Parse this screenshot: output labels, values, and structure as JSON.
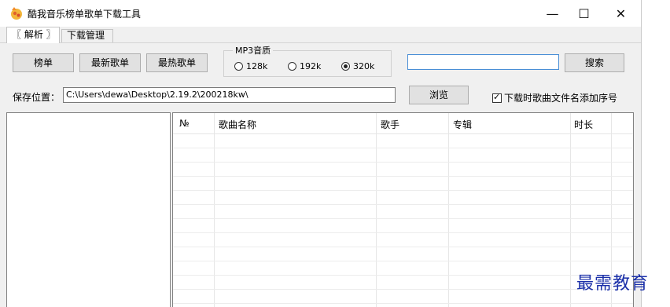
{
  "window": {
    "title": "酷我音乐榜单歌单下载工具",
    "controls": {
      "minimize": "—",
      "maximize": "☐",
      "close": "✕"
    }
  },
  "tabs": [
    {
      "label": "〖 解析 〗",
      "active": true
    },
    {
      "label": "下载管理",
      "active": false
    }
  ],
  "toolbar": {
    "chart_button": "榜单",
    "newest_playlist_button": "最新歌单",
    "hottest_playlist_button": "最热歌单"
  },
  "quality": {
    "legend": "MP3音质",
    "options": [
      "128k",
      "192k",
      "320k"
    ],
    "selected": "320k"
  },
  "search": {
    "value": "",
    "button": "搜索"
  },
  "save": {
    "label": "保存位置：",
    "path": "C:\\Users\\dewa\\Desktop\\2.19.2\\200218kw\\",
    "browse_button": "浏览",
    "checkbox_label": "下载时歌曲文件名添加序号",
    "checkbox_checked": true
  },
  "table": {
    "columns": [
      "№",
      "歌曲名称",
      "歌手",
      "专辑",
      "时长"
    ],
    "rows": []
  },
  "watermark": "最需教育",
  "colors": {
    "window_bg": "#f0f0f0",
    "button_bg": "#e1e1e1",
    "focus_border": "#4a8fd6",
    "watermark": "#1a2fa8"
  }
}
